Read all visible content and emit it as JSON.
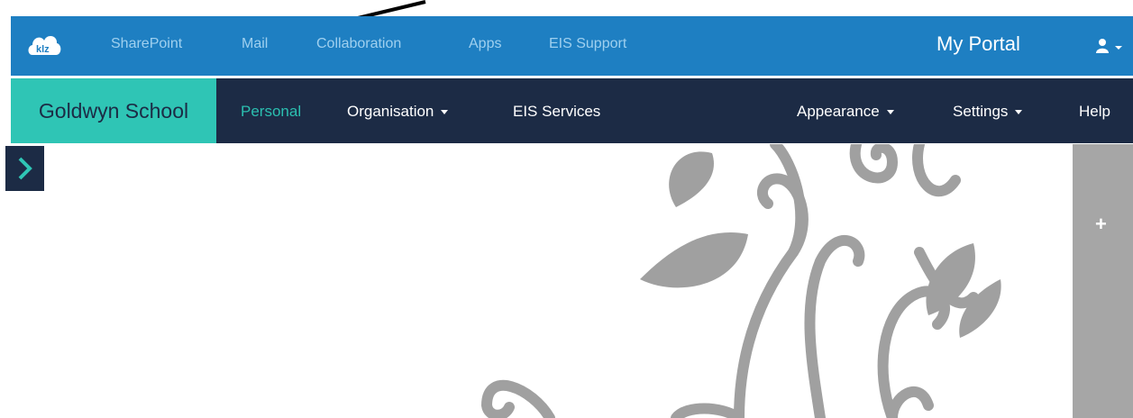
{
  "top_nav": {
    "logo_text": "klz",
    "items": [
      {
        "label": "SharePoint"
      },
      {
        "label": "Mail"
      },
      {
        "label": "Collaboration"
      },
      {
        "label": "Apps"
      },
      {
        "label": "EIS Support"
      }
    ],
    "portal_title": "My Portal",
    "user_icon": "user-icon"
  },
  "main_nav": {
    "brand": "Goldwyn School",
    "items": [
      {
        "label": "Personal",
        "active": true
      },
      {
        "label": "Organisation"
      },
      {
        "label": "EIS Services"
      },
      {
        "label": "Appearance"
      },
      {
        "label": "Settings"
      },
      {
        "label": "Help"
      }
    ]
  },
  "side": {
    "expand_icon": "chevron-right-icon",
    "add_icon": "plus-icon",
    "add_label": "+"
  },
  "colors": {
    "top_bar": "#1e7fc2",
    "sub_bar": "#1c2b45",
    "brand": "#2fc5b5",
    "active": "#2bbfb0",
    "panel": "#a6a6a6"
  }
}
